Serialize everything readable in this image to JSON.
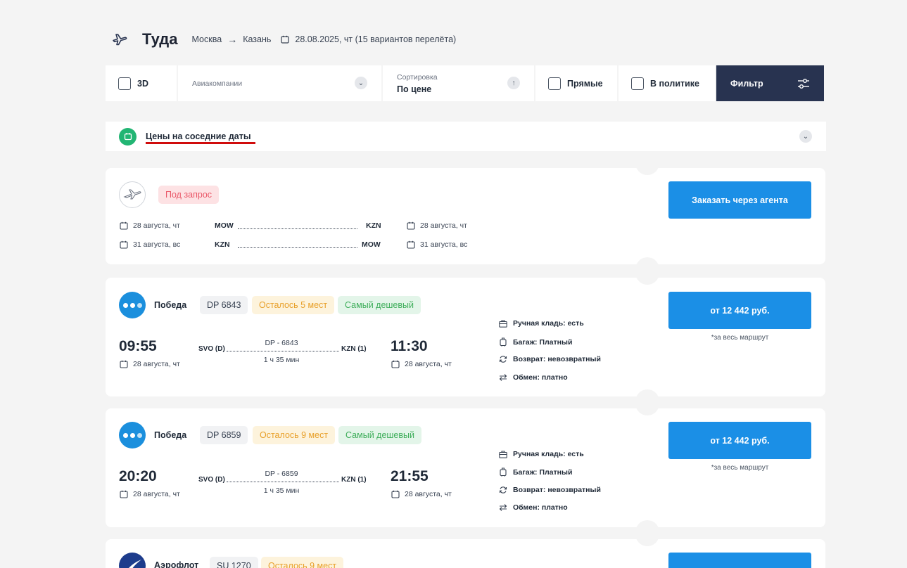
{
  "header": {
    "title": "Туда",
    "from": "Москва",
    "to": "Казань",
    "date_info": "28.08.2025, чт (15 вариантов перелёта)"
  },
  "filters": {
    "three_d": "3D",
    "airlines_label": "Авиакомпании",
    "sort_label": "Сортировка",
    "sort_value": "По цене",
    "direct": "Прямые",
    "in_policy": "В политике",
    "filter": "Фильтр"
  },
  "nearby": {
    "label": "Цены на соседние даты"
  },
  "request_card": {
    "badge": "Под запрос",
    "button": "Заказать через агента",
    "legs": [
      {
        "dep_date": "28 августа, чт",
        "from": "MOW",
        "to": "KZN",
        "arr_date": "28 августа, чт"
      },
      {
        "dep_date": "31 августа, вс",
        "from": "KZN",
        "to": "MOW",
        "arr_date": "31 августа, вс"
      }
    ]
  },
  "flights": [
    {
      "airline": "Победа",
      "flight": "DP 6843",
      "seats": "Осталось 5 мест",
      "tag": "Самый дешевый",
      "dep_time": "09:55",
      "dep_date": "28 августа, чт",
      "from": "SVO (D)",
      "to": "KZN (1)",
      "code": "DP - 6843",
      "duration": "1 ч 35 мин",
      "arr_time": "11:30",
      "arr_date": "28 августа, чт",
      "hand": "Ручная кладь: есть",
      "baggage": "Багаж: Платный",
      "refund": "Возврат: невозвратный",
      "exchange": "Обмен: платно",
      "price": "от 12 442 руб.",
      "note": "*за весь маршрут"
    },
    {
      "airline": "Победа",
      "flight": "DP 6859",
      "seats": "Осталось 9 мест",
      "tag": "Самый дешевый",
      "dep_time": "20:20",
      "dep_date": "28 августа, чт",
      "from": "SVO (D)",
      "to": "KZN (1)",
      "code": "DP - 6859",
      "duration": "1 ч 35 мин",
      "arr_time": "21:55",
      "arr_date": "28 августа, чт",
      "hand": "Ручная кладь: есть",
      "baggage": "Багаж: Платный",
      "refund": "Возврат: невозвратный",
      "exchange": "Обмен: платно",
      "price": "от 12 442 руб.",
      "note": "*за весь маршрут"
    },
    {
      "airline": "Аэрофлот",
      "flight": "SU 1270",
      "seats": "Осталось 9 мест"
    }
  ],
  "colors": {
    "accent": "#1b8fe6",
    "dark_button": "#283350",
    "green": "#22b573"
  }
}
